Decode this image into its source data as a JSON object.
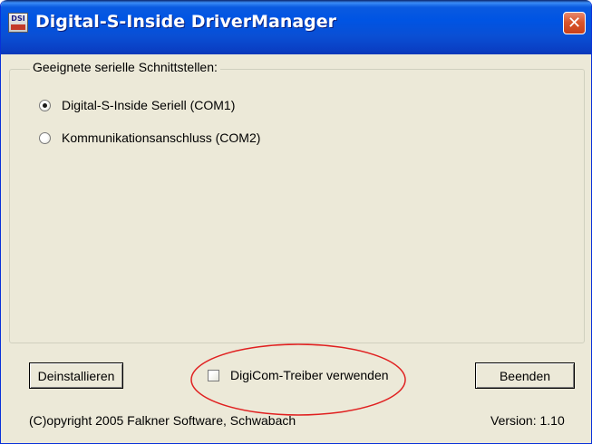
{
  "window": {
    "title": "Digital-S-Inside DriverManager",
    "icon_label": "DSI",
    "close_glyph": "✕"
  },
  "group": {
    "legend": "Geeignete serielle Schnittstellen:",
    "ports": [
      {
        "label": "Digital-S-Inside Seriell (COM1)",
        "selected": true
      },
      {
        "label": "Kommunikationsanschluss (COM2)",
        "selected": false
      }
    ]
  },
  "buttons": {
    "uninstall": "Deinstallieren",
    "exit": "Beenden"
  },
  "checkbox": {
    "label": "DigiCom-Treiber verwenden",
    "checked": false
  },
  "footer": {
    "copyright": "(C)opyright 2005 Falkner Software, Schwabach",
    "version": "Version: 1.10"
  },
  "colors": {
    "titlebar": "#0054e3",
    "window_bg": "#ece9d8",
    "close_button": "#d9562c",
    "highlight_ellipse": "#e02020"
  },
  "icons": [
    "app-icon",
    "close-icon",
    "radio-icon",
    "checkbox-icon"
  ]
}
